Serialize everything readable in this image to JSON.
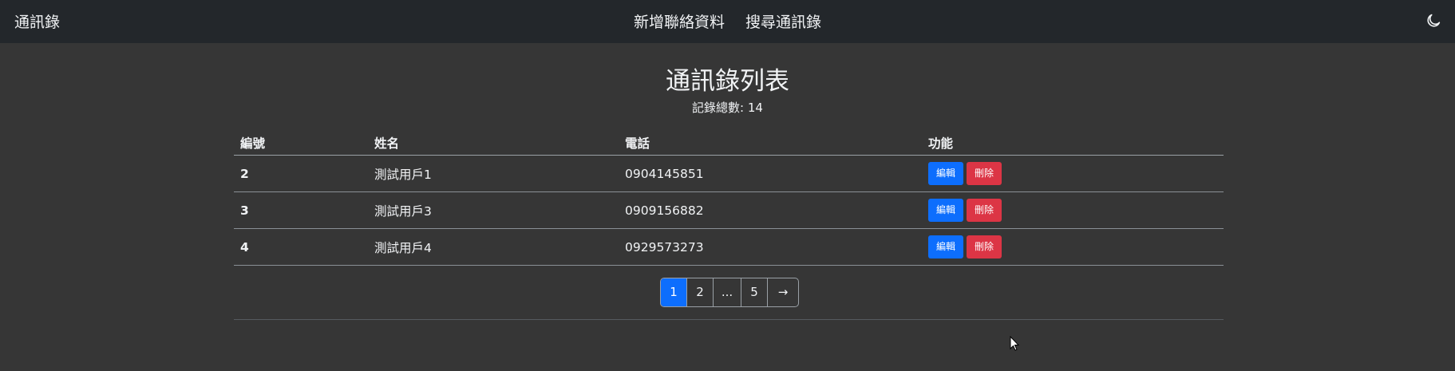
{
  "navbar": {
    "brand": "通訊錄",
    "links": [
      "新增聯絡資料",
      "搜尋通訊錄"
    ],
    "theme_icon": "moon-icon"
  },
  "main": {
    "title": "通訊錄列表",
    "record_count": "記錄總數: 14"
  },
  "table": {
    "headers": [
      "編號",
      "姓名",
      "電話",
      "功能"
    ],
    "edit_label": "編輯",
    "delete_label": "刪除",
    "rows": [
      {
        "id": "2",
        "name": "測試用戶1",
        "phone": "0904145851"
      },
      {
        "id": "3",
        "name": "測試用戶3",
        "phone": "0909156882"
      },
      {
        "id": "4",
        "name": "測試用戶4",
        "phone": "0929573273"
      }
    ]
  },
  "pagination": {
    "pages": [
      "1",
      "2",
      "...",
      "5",
      "→"
    ],
    "current": "1"
  },
  "colors": {
    "navbar_bg": "#23272b",
    "page_bg": "#363636",
    "primary": "#0d6efd",
    "danger": "#dc3545"
  }
}
